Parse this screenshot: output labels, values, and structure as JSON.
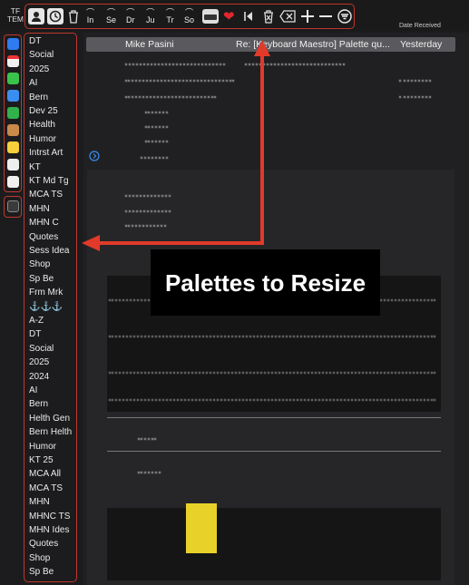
{
  "toolbar": {
    "tf_line1": "TF",
    "tf_line2": "TEM",
    "stack_buttons": [
      {
        "label": "In",
        "icon": "hat-icon"
      },
      {
        "label": "Se",
        "icon": "hat-icon"
      },
      {
        "label": "Dr",
        "icon": "hat-icon"
      },
      {
        "label": "Ju",
        "icon": "hat-icon"
      },
      {
        "label": "Tr",
        "icon": "hat-icon"
      },
      {
        "label": "So",
        "icon": "hat-icon"
      }
    ]
  },
  "sort": {
    "label": "Date Received"
  },
  "message": {
    "from": "Mike Pasini",
    "subject": "Re: [Keyboard Maestro] Palette qu...",
    "date": "Yesterday"
  },
  "palettes": [
    "DT",
    "Social",
    "2025",
    "AI",
    "Bern",
    "Dev 25",
    "Health",
    "Humor",
    "Intrst Art",
    "KT",
    "KT Md Tg",
    "MCA TS",
    "MHN",
    "MHN C",
    "Quotes",
    "Sess Idea",
    "Shop",
    "Sp Be",
    "Frm Mrk",
    "⚓⚓⚓",
    "A-Z",
    "DT",
    "Social",
    "2025",
    "2024",
    "AI",
    "Bern",
    "Helth Gen",
    "Bern Helth",
    "Humor",
    "KT 25",
    "MCA All",
    "MCA TS",
    "MHN",
    "MHNC TS",
    "MHN Ides",
    "Quotes",
    "Shop",
    "Sp Be"
  ],
  "callout": {
    "text": "Palettes to Resize"
  },
  "colors": {
    "annotation": "#e23a2a",
    "frame": "#c0362c"
  }
}
